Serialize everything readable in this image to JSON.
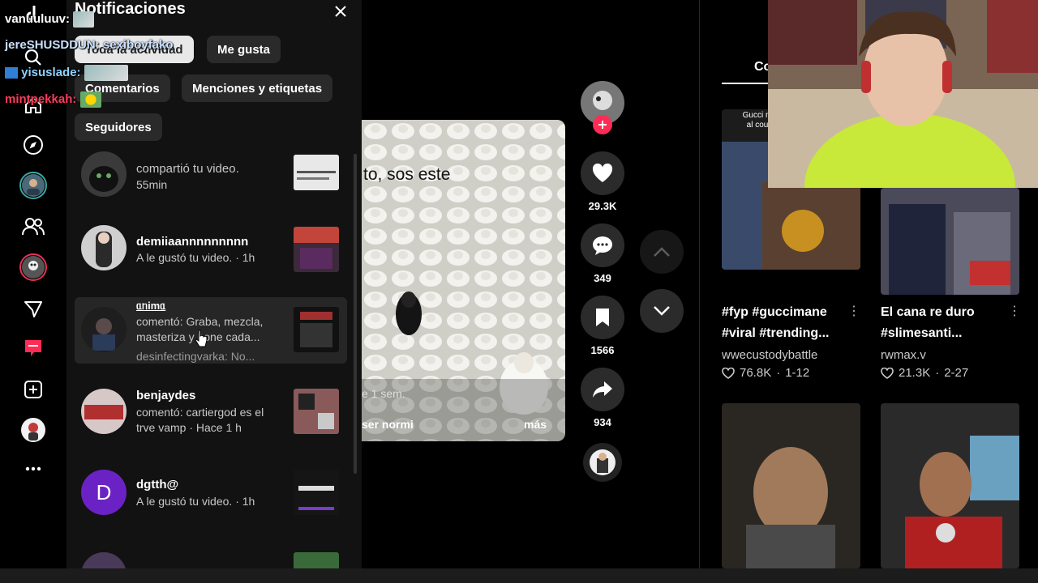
{
  "panel": {
    "title": "Notificaciones",
    "tabs": [
      {
        "label": "Toda la actividad",
        "active": true
      },
      {
        "label": "Me gusta",
        "active": false
      },
      {
        "label": "Comentarios",
        "active": false
      },
      {
        "label": "Menciones y etiquetas",
        "active": false
      },
      {
        "label": "Seguidores",
        "active": false
      }
    ],
    "notifications": [
      {
        "user": "",
        "text": "compartió tu video.",
        "time": "55min"
      },
      {
        "user": "demiiaannnnnnnnn",
        "text": "A le gustó tu video. · 1h"
      },
      {
        "user": "ᥲᥒіmᥲ",
        "text": "comentó: Graba, mezcla, masteriza y pone cada...",
        "extra": "desinfectingvarka: No..."
      },
      {
        "user": "benjaydes",
        "text": "comentó: cartiergod es el trve vamp · Hace 1 h"
      },
      {
        "user": "dgtth@",
        "text": "A le gustó tu video. · 1h",
        "avatar_letter": "D"
      }
    ]
  },
  "chat": [
    {
      "user": "vanuuluuv:",
      "color": "#ffffff"
    },
    {
      "user": "jereSHUSDDUN:",
      "message": "sexiboyfako",
      "color": "#6fa8ff"
    },
    {
      "user": "yisuslade:",
      "color": "#8fd3ff"
    },
    {
      "user": "mintpekkah:",
      "color": "#ff3b5c"
    }
  ],
  "video": {
    "caption": "to, sos este",
    "time_fragment": "e 1 sem.",
    "desc_fragment": "ser normi",
    "more_label": "más"
  },
  "actions": {
    "likes": "29.3K",
    "comments": "349",
    "saves": "1566",
    "shares": "934"
  },
  "explore": {
    "header_fragment": "Co",
    "items": [
      {
        "caption": "#fyp #guccimane #viral #trending...",
        "user": "wwecustodybattle",
        "likes": "76.8K",
        "date": "1-12",
        "thumb_text": "Gucci m al cou"
      },
      {
        "caption": "El cana re duro #slimesanti...",
        "user": "rwmax.v",
        "likes": "21.3K",
        "date": "2-27"
      }
    ]
  },
  "colors": {
    "brand": "#fe2c55",
    "panel_bg": "#121212",
    "chip_bg": "#2a2a2a"
  }
}
